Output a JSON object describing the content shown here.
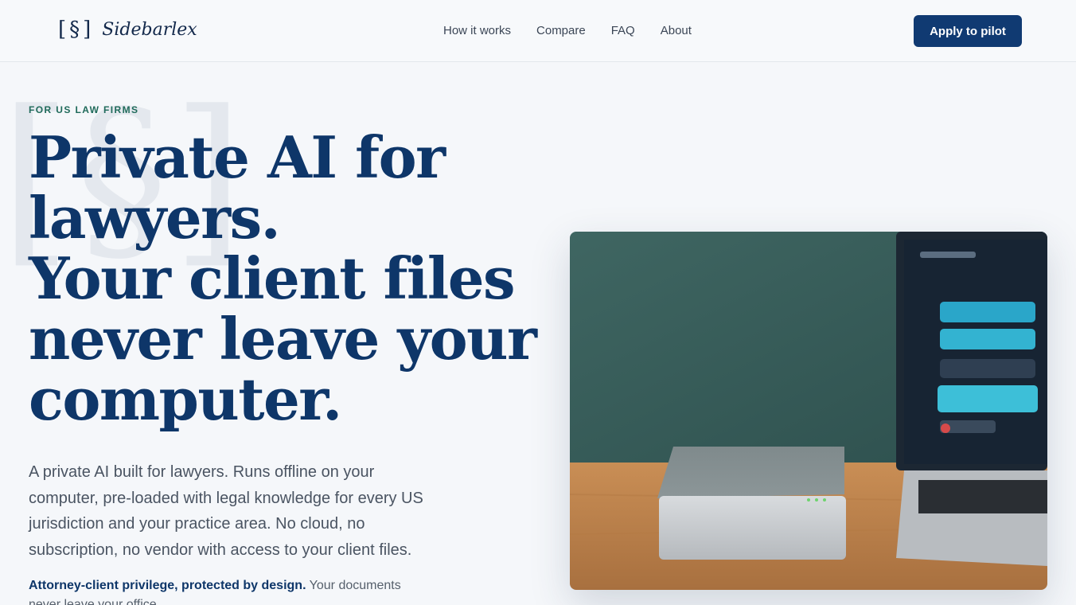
{
  "brand": {
    "mark": "[§]",
    "name": "Sidebarlex"
  },
  "nav": {
    "items": [
      "How it works",
      "Compare",
      "FAQ",
      "About"
    ]
  },
  "cta": {
    "label": "Apply to pilot"
  },
  "hero": {
    "watermark": "[§]",
    "eyebrow": "FOR US LAW FIRMS",
    "headline_lines": [
      "Private AI for",
      "lawyers.",
      "Your client files",
      "never leave your",
      "computer."
    ],
    "lede": "A private AI built for lawyers. Runs offline on your computer, pre-loaded with legal knowledge for every US jurisdiction and your practice area. No cloud, no subscription, no vendor with access to your client files.",
    "privilege_strong": "Attorney-client privilege, protected by design.",
    "privilege_rest": " Your documents never leave your office."
  },
  "colors": {
    "accent": "#103a72",
    "headline": "#0e3669",
    "eyebrow": "#1f6a5a",
    "background": "#f5f7fa"
  },
  "icons": {
    "logo": "section-sign-bracket-icon"
  }
}
